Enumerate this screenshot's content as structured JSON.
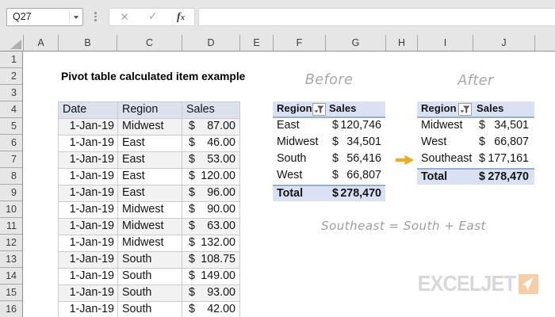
{
  "name_box": {
    "value": "Q27"
  },
  "formula_bar": {
    "cancel_icon": "✕",
    "enter_icon": "✓",
    "fx_f": "f",
    "fx_x": "x",
    "value": ""
  },
  "grid": {
    "column_headers": [
      "A",
      "B",
      "C",
      "D",
      "E",
      "F",
      "G",
      "H",
      "I",
      "J"
    ],
    "row_headers": [
      "1",
      "2",
      "3",
      "4",
      "5",
      "6",
      "7",
      "8",
      "9",
      "10",
      "11",
      "12",
      "13",
      "14",
      "15",
      "16"
    ]
  },
  "sheet": {
    "title": "Pivot table calculated item example",
    "data_table": {
      "headers": [
        "Date",
        "Region",
        "Sales"
      ],
      "rows": [
        {
          "date": "1-Jan-19",
          "region": "Midwest",
          "currency": "$",
          "amount": "87.00"
        },
        {
          "date": "1-Jan-19",
          "region": "East",
          "currency": "$",
          "amount": "46.00"
        },
        {
          "date": "1-Jan-19",
          "region": "East",
          "currency": "$",
          "amount": "53.00"
        },
        {
          "date": "1-Jan-19",
          "region": "East",
          "currency": "$",
          "amount": "120.00"
        },
        {
          "date": "1-Jan-19",
          "region": "East",
          "currency": "$",
          "amount": "96.00"
        },
        {
          "date": "1-Jan-19",
          "region": "Midwest",
          "currency": "$",
          "amount": "90.00"
        },
        {
          "date": "1-Jan-19",
          "region": "Midwest",
          "currency": "$",
          "amount": "63.00"
        },
        {
          "date": "1-Jan-19",
          "region": "Midwest",
          "currency": "$",
          "amount": "132.00"
        },
        {
          "date": "1-Jan-19",
          "region": "South",
          "currency": "$",
          "amount": "108.75"
        },
        {
          "date": "1-Jan-19",
          "region": "South",
          "currency": "$",
          "amount": "149.00"
        },
        {
          "date": "1-Jan-19",
          "region": "South",
          "currency": "$",
          "amount": "93.00"
        },
        {
          "date": "1-Jan-19",
          "region": "South",
          "currency": "$",
          "amount": "42.00"
        }
      ]
    },
    "before_pivot": {
      "caption": "Before",
      "region_header": "Region",
      "sales_header": "Sales",
      "rows": [
        {
          "region": "East",
          "currency": "$",
          "amount": "120,746"
        },
        {
          "region": "Midwest",
          "currency": "$",
          "amount": "34,501"
        },
        {
          "region": "South",
          "currency": "$",
          "amount": "56,416"
        },
        {
          "region": "West",
          "currency": "$",
          "amount": "66,807"
        }
      ],
      "total": {
        "label": "Total",
        "currency": "$",
        "amount": "278,470"
      }
    },
    "after_pivot": {
      "caption": "After",
      "region_header": "Region",
      "sales_header": "Sales",
      "rows": [
        {
          "region": "Midwest",
          "currency": "$",
          "amount": "34,501"
        },
        {
          "region": "West",
          "currency": "$",
          "amount": "66,807"
        },
        {
          "region": "Southeast",
          "currency": "$",
          "amount": "177,161"
        }
      ],
      "total": {
        "label": "Total",
        "currency": "$",
        "amount": "278,470"
      }
    },
    "annotation": "Southeast = South + East",
    "logo_text": "EXCELJET"
  },
  "colors": {
    "chrome_bg": "#E6E6E6",
    "pivot_header_bg": "#D9E1F2",
    "pivot_border": "#94AFD7",
    "data_table_header_bg": "#DBE1ED",
    "banded_row_bg": "#F2F2F2",
    "arrow": "#E9AF23",
    "logo_square": "#F9CDA2",
    "logo_text": "#D8D8D8"
  }
}
